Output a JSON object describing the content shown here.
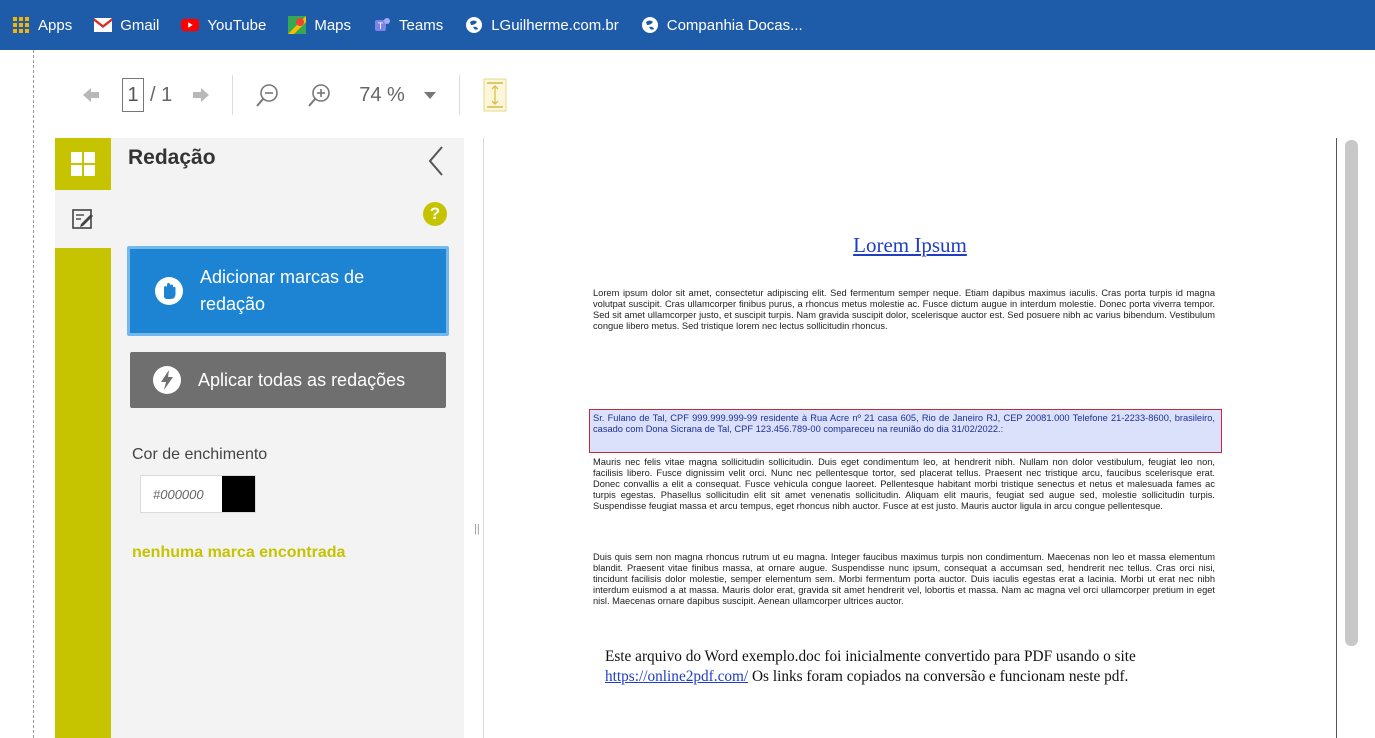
{
  "bookmarks": [
    {
      "label": "Apps",
      "icon": "apps-grid-icon"
    },
    {
      "label": "Gmail",
      "icon": "gmail-icon"
    },
    {
      "label": "YouTube",
      "icon": "youtube-icon"
    },
    {
      "label": "Maps",
      "icon": "maps-icon"
    },
    {
      "label": "Teams",
      "icon": "teams-icon"
    },
    {
      "label": "LGuilherme.com.br",
      "icon": "globe-icon"
    },
    {
      "label": "Companhia Docas...",
      "icon": "globe-icon"
    }
  ],
  "toolbar": {
    "page_current": "1",
    "page_total": "/ 1",
    "zoom": "74 %"
  },
  "sidebar": {
    "title": "Redação",
    "add_marks_label": "Adicionar marcas de redação",
    "apply_all_label": "Aplicar todas as redações",
    "fill_color_label": "Cor de enchimento",
    "fill_color_value": "#000000",
    "no_marks": "nenhuma marca encontrada",
    "accent_color": "#c6c300"
  },
  "document": {
    "title": "Lorem Ipsum",
    "para1": "Lorem ipsum dolor sit amet, consectetur adipiscing elit. Sed fermentum semper neque. Etiam dapibus maximus iaculis. Cras porta turpis id magna volutpat suscipit. Cras ullamcorper finibus purus, a rhoncus metus molestie ac. Fusce dictum augue in interdum molestie. Donec porta viverra tempor. Sed sit amet ullamcorper justo, et suscipit turpis. Nam gravida suscipit dolor, scelerisque auctor est. Sed posuere nibh ac varius bibendum. Vestibulum congue libero metus. Sed tristique lorem nec lectus sollicitudin rhoncus.",
    "para_highlight": "Sr. Fulano de Tal, CPF 999.999.999-99 residente à Rua Acre nº 21 casa 605, Rio de Janeiro RJ, CEP 20081.000 Telefone 21-2233-8600, brasileiro, casado com Dona Sicrana de Tal, CPF 123.456.789-00 compareceu na reunião do dia 31/02/2022.:",
    "para2": "Mauris nec felis vitae magna sollicitudin sollicitudin. Duis eget condimentum leo, at hendrerit nibh. Nullam non dolor vestibulum, feugiat leo non, facilisis libero. Fusce dignissim velit orci. Nunc nec pellentesque tortor, sed placerat tellus. Praesent nec tristique arcu, faucibus scelerisque erat. Donec convallis a elit a consequat. Fusce vehicula congue laoreet. Pellentesque habitant morbi tristique senectus et netus et malesuada fames ac turpis egestas. Phasellus sollicitudin elit sit amet venenatis sollicitudin. Aliquam elit mauris, feugiat sed augue sed, molestie sollicitudin turpis. Suspendisse feugiat massa et arcu tempus, eget rhoncus nibh auctor. Fusce at est justo. Mauris auctor ligula in arcu congue pellentesque.",
    "para3": "Duis quis sem non magna rhoncus rutrum ut eu magna. Integer faucibus maximus turpis non condimentum. Maecenas non leo et massa elementum blandit. Praesent vitae finibus massa, at ornare augue. Suspendisse nunc ipsum, consequat a accumsan sed, hendrerit nec tellus. Cras orci nisi, tincidunt facilisis dolor molestie, semper elementum sem. Morbi fermentum porta auctor. Duis iaculis egestas erat a lacinia. Morbi ut erat nec nibh interdum euismod a at massa. Mauris dolor erat, gravida sit amet hendrerit vel, lobortis et massa. Nam ac magna vel orci ullamcorper pretium in eget nisl. Maecenas ornare dapibus suscipit. Aenean ullamcorper ultrices auctor.",
    "footer_before": "Este arquivo do Word exemplo.doc foi inicialmente convertido para PDF usando o site ",
    "footer_link": "https://online2pdf.com/",
    "footer_after": " Os links foram copiados na conversão e funcionam neste pdf."
  }
}
